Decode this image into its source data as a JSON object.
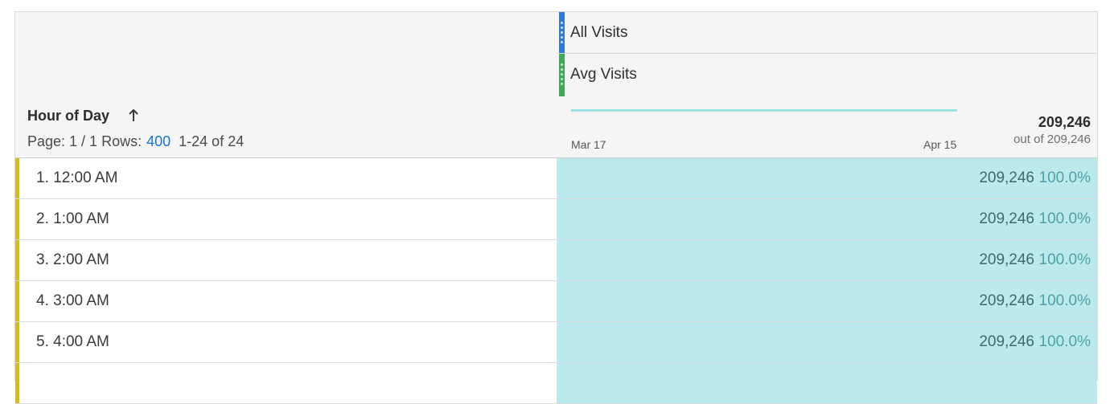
{
  "segments": [
    {
      "label": "All Visits",
      "color": "#2d7ad8"
    },
    {
      "label": "Avg Visits",
      "color": "#3dab53"
    }
  ],
  "dimension": {
    "title": "Hour of Day",
    "sort_icon": "arrow-up-icon"
  },
  "pager": {
    "page_text": "Page: 1 / 1",
    "rows_label": "Rows:",
    "rows_value": "400",
    "range_text": "1-24 of 24"
  },
  "metric": {
    "date_start": "Mar 17",
    "date_end": "Apr 15",
    "total": "209,246",
    "out_of": "out of 209,246"
  },
  "rows": [
    {
      "label": "1. 12:00 AM",
      "value": "209,246",
      "percent": "100.0%"
    },
    {
      "label": "2. 1:00 AM",
      "value": "209,246",
      "percent": "100.0%"
    },
    {
      "label": "3. 2:00 AM",
      "value": "209,246",
      "percent": "100.0%"
    },
    {
      "label": "4. 3:00 AM",
      "value": "209,246",
      "percent": "100.0%"
    },
    {
      "label": "5. 4:00 AM",
      "value": "209,246",
      "percent": "100.0%"
    }
  ],
  "colors": {
    "accent_row": "#d6bb1f",
    "cell_fill": "#bceaec",
    "link_blue": "#1473e6"
  }
}
